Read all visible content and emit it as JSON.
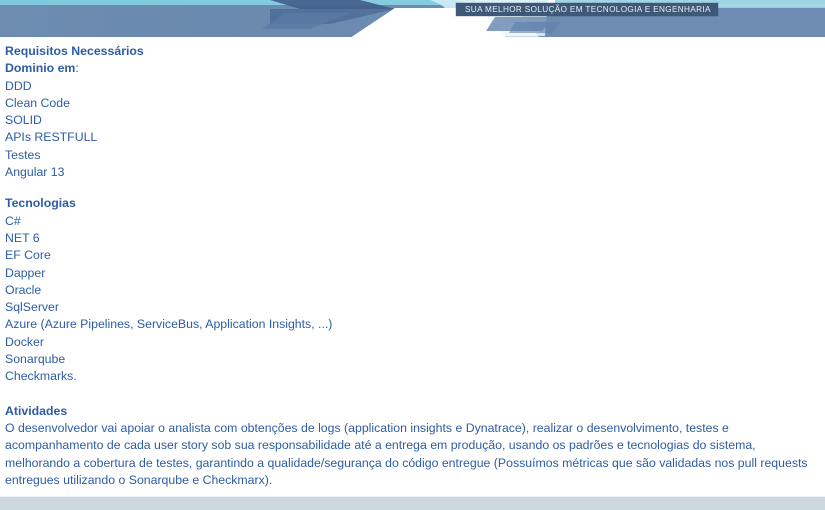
{
  "header": {
    "ribbon_text": "SUA MELHOR SOLUÇÃO EM TECNOLOGIA E ENGENHARIA",
    "colors": {
      "top_band": "#7ec9dd",
      "main_band": "#6a8aaf",
      "arrow_dark": "#44618d",
      "arrow_mid": "#5e7ea6",
      "pale_cyan": "#cfeaf4",
      "ribbon_bg": "#3e5877",
      "ribbon_text": "#e9eef5"
    }
  },
  "body_text_color": "#2d5ca6",
  "sections": {
    "requisitos": {
      "title": "Requisitos Necessários",
      "subtitle_bold": "Dominio em",
      "subtitle_rest": ":",
      "items": [
        "DDD",
        "Clean Code",
        "SOLID",
        "APIs RESTFULL",
        "Testes",
        "Angular 13"
      ]
    },
    "tecnologias": {
      "title": "Tecnologias",
      "items": [
        "C#",
        "NET 6",
        "EF Core",
        "Dapper",
        "Oracle",
        "SqlServer",
        "Azure (Azure Pipelines, ServiceBus, Application Insights, ...)",
        "Docker",
        "Sonarqube",
        "Checkmarks."
      ]
    },
    "atividades": {
      "title": "Atividades",
      "paragraph": "O desenvolvedor vai apoiar o analista com obtenções de logs (application insights e Dynatrace), realizar o desenvolvimento, testes e acompanhamento de cada user story sob sua responsabilidade até a entrega em produção, usando os padrões e tecnologias do sistema, melhorando a cobertura de testes, garantindo a qualidade/segurança do código entregue (Possuímos métricas que são validadas nos pull requests entregues utilizando o Sonarqube e Checkmarx)."
    }
  },
  "footer": {
    "bar_color": "#ccd8dd"
  }
}
